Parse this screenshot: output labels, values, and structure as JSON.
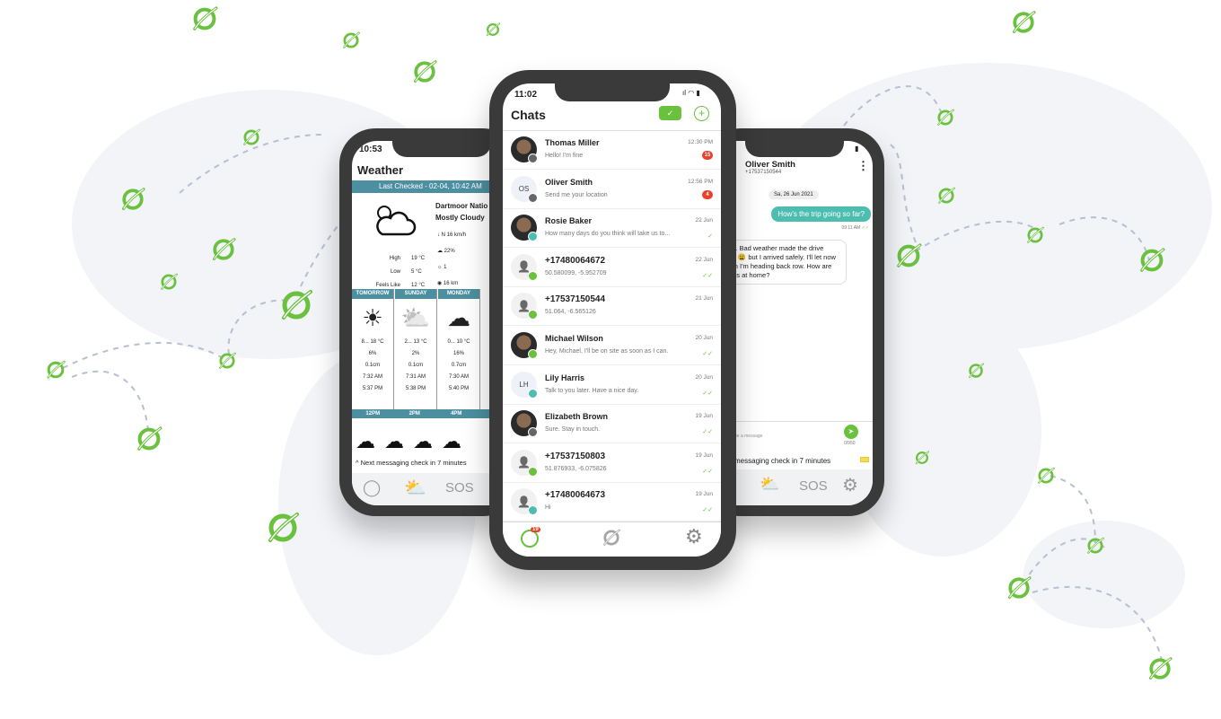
{
  "colors": {
    "brand_green": "#6ac13e",
    "teal": "#4b8fa0",
    "bubble_teal": "#4dbdb0",
    "badge_red": "#e8412c",
    "frame": "#3a3a3a"
  },
  "center_phone": {
    "status_time": "11:02",
    "title": "Chats",
    "header_icons": [
      "check-icon",
      "new-chat-icon"
    ],
    "chats": [
      {
        "name": "Thomas Miller",
        "message": "Hello! I'm fine",
        "time": "12:30 PM",
        "badge": "15",
        "avatar": "photo",
        "status_color": "#666"
      },
      {
        "name": "Oliver Smith",
        "initials": "OS",
        "message": "Send me your location",
        "time": "12:56 PM",
        "badge": "4",
        "status_color": "#666"
      },
      {
        "name": "Rosie Baker",
        "message": "How many days do you think will take us to...",
        "time": "22 Jun",
        "avatar": "photo",
        "status_color": "#4dbdb0",
        "check": "✓"
      },
      {
        "name": "+17480064672",
        "message": "50.580099, -5.952709",
        "time": "22 Jun",
        "avatar": "person",
        "status_color": "#6ac13e",
        "check": "✓✓"
      },
      {
        "name": "+17537150544",
        "message": "51.064, -6.565126",
        "time": "21 Jun",
        "avatar": "person",
        "status_color": "#6ac13e"
      },
      {
        "name": "Michael Wilson",
        "message": "Hey, Michael, I'll be on site as soon as I can.",
        "time": "20 Jun",
        "avatar": "photo",
        "status_color": "#6ac13e",
        "check": "✓✓"
      },
      {
        "name": "Lily Harris",
        "initials": "LH",
        "message": "Talk to you later. Have a nice day.",
        "time": "20 Jun",
        "status_color": "#4dbdb0",
        "check": "✓✓"
      },
      {
        "name": "Elizabeth Brown",
        "message": "Sure. Stay in touch.",
        "time": "19 Jun",
        "avatar": "photo",
        "status_color": "#666",
        "check": "✓✓"
      },
      {
        "name": "+17537150803",
        "message": "51.876933, -6.075826",
        "time": "19 Jun",
        "avatar": "person",
        "status_color": "#6ac13e",
        "check": "✓✓"
      },
      {
        "name": "+17480064673",
        "message": "Hi",
        "time": "19 Jun",
        "avatar": "person",
        "status_color": "#4dbdb0",
        "check": "✓✓"
      }
    ],
    "tabbar": {
      "chat_badge": "19",
      "tabs": [
        "chats-icon",
        "satellite-icon",
        "settings-icon"
      ]
    }
  },
  "left_phone": {
    "status_time": "10:53",
    "title": "Weather",
    "last_checked": "Last Checked - 02-04, 10:42 AM",
    "location": "Dartmoor Natio",
    "condition": "Mostly Cloudy",
    "high_label": "High",
    "high": "19 °C",
    "low_label": "Low",
    "low": "5 °C",
    "feels_label": "Feels Like",
    "feels": "12 °C",
    "wind": "N 16 km/h",
    "cloud": "22%",
    "uv": "1",
    "visibility": "16 km",
    "days": [
      {
        "label": "TOMORROW",
        "temp": "8... 18 °C",
        "rain": "6%",
        "precip": "0.1cm",
        "sunrise": "7:32 AM",
        "sunset": "5:37 PM",
        "icon": "sun"
      },
      {
        "label": "SUNDAY",
        "temp": "2... 13 °C",
        "rain": "2%",
        "precip": "0.1cm",
        "sunrise": "7:31 AM",
        "sunset": "5:38 PM",
        "icon": "partly"
      },
      {
        "label": "MONDAY",
        "temp": "0... 10 °C",
        "rain": "16%",
        "precip": "0.7cm",
        "sunrise": "7:30 AM",
        "sunset": "5:40 PM",
        "icon": "cloud"
      }
    ],
    "hours": [
      "12PM",
      "2PM",
      "4PM",
      "6PM"
    ],
    "next_check": "Next messaging check in 7 minutes",
    "tabs": {
      "sos": "SOS"
    }
  },
  "right_phone": {
    "contact_name": "Oliver Smith",
    "contact_number": "+17537150544",
    "date_pill": "Sa, 26 Jun 2021",
    "outgoing": "How's the trip going so far?",
    "outgoing_time": "09:11 AM",
    "incoming": "okay. Bad weather made the drive sting 😩 but I arrived safely. I'll let now when I'm heading back row. How are things at home?",
    "input_placeholder": "pe a message",
    "char_count": "0/950",
    "next_check": "messaging check in 7 minutes",
    "tabs": {
      "sos": "SOS"
    }
  }
}
